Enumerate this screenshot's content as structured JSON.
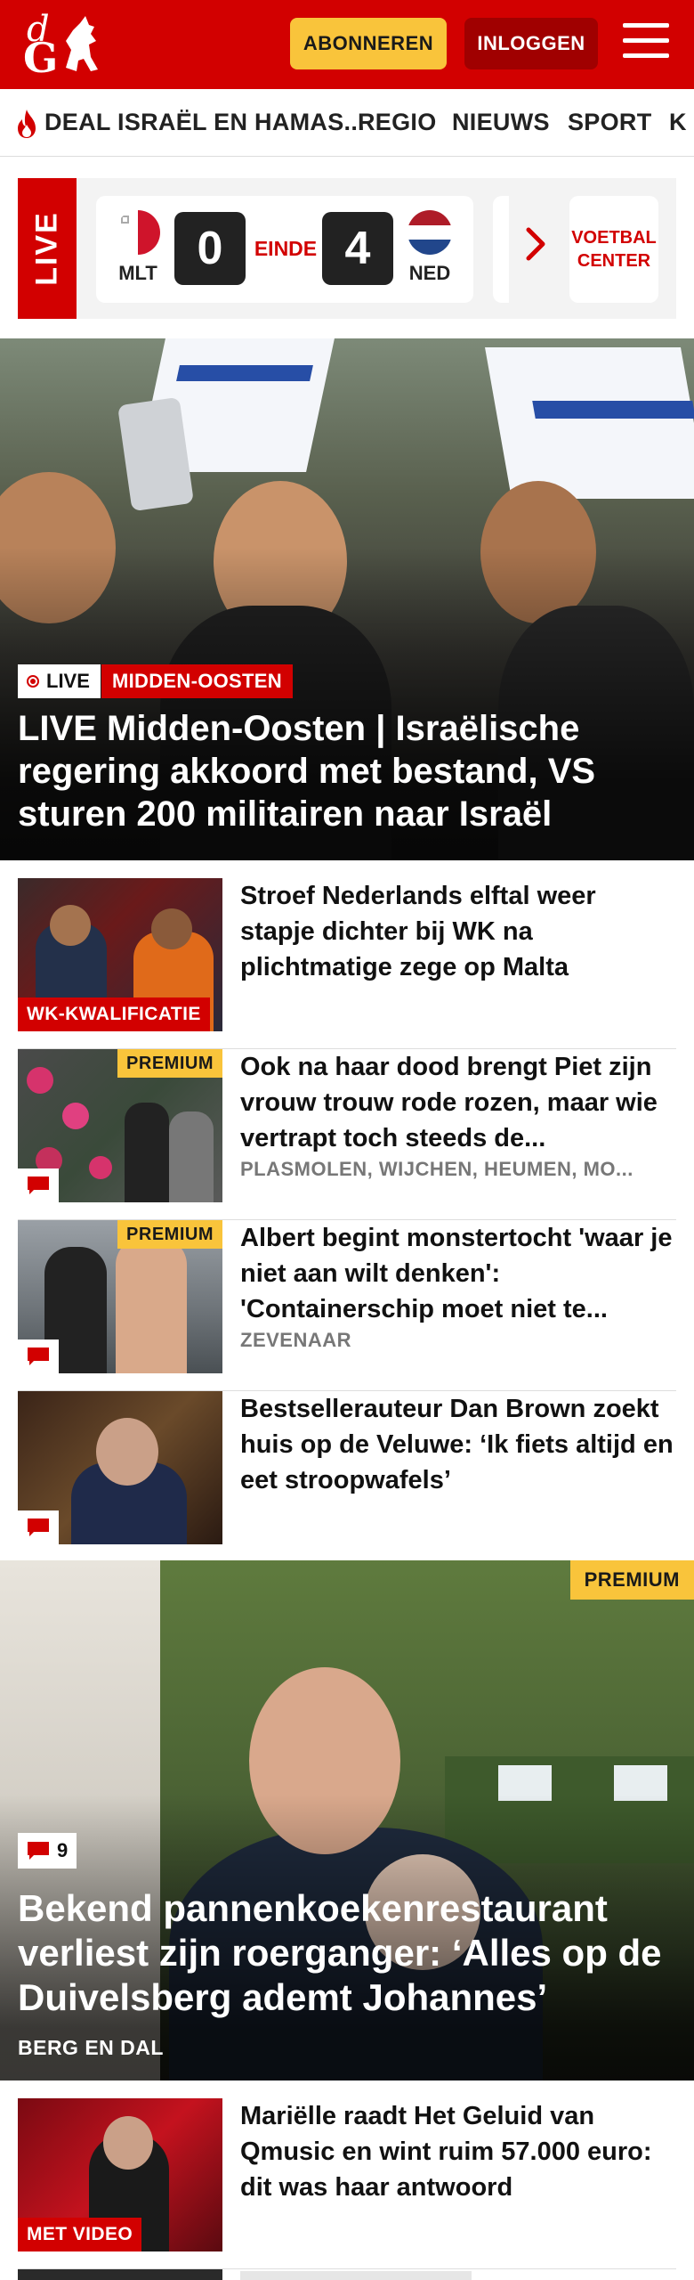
{
  "header": {
    "subscribe_label": "ABONNEREN",
    "login_label": "INLOGGEN",
    "logo_letters": "dG",
    "brand_color": "#d20000"
  },
  "nav": {
    "items": [
      "DEAL ISRAËL EN HAMAS...",
      "REGIO",
      "NIEUWS",
      "SPORT",
      "K"
    ]
  },
  "live": {
    "tab_label": "LIVE",
    "home_code": "MLT",
    "home_score": "0",
    "status": "EINDE",
    "away_score": "4",
    "away_code": "NED",
    "center_label_1": "VOETBAL",
    "center_label_2": "CENTER"
  },
  "hero": {
    "live_label": "LIVE",
    "category": "MIDDEN-OOSTEN",
    "title": "LIVE Midden-Oosten | Israëlische regering akkoord met bestand, VS sturen 200 militairen naar Israël"
  },
  "articles": [
    {
      "title": "Stroef Nederlands elftal weer stapje dichter bij WK na plichtmatige zege op Malta",
      "tag": "WK-KWALIFICATIE"
    },
    {
      "title": "Ook na haar dood brengt Piet zijn vrouw trouw rode rozen, maar wie vertrapt toch steeds de...",
      "location": "PLASMOLEN, WIJCHEN, HEUMEN, MO...",
      "premium": "PREMIUM"
    },
    {
      "title": "Albert begint monstertocht 'waar je niet aan wilt denken': 'Containerschip moet niet te...",
      "location": "ZEVENAAR",
      "premium": "PREMIUM"
    },
    {
      "title": "Bestsellerauteur Dan Brown zoekt huis op de Veluwe: ‘Ik fiets altijd en eet stroopwafels’"
    }
  ],
  "feature": {
    "premium": "PREMIUM",
    "comments": "9",
    "title": "Bekend pannenkoekenrestaurant verliest zijn roerganger: ‘Alles op de Duivelsberg ademt Johannes’",
    "location": "BERG EN DAL"
  },
  "bottom_article": {
    "title": "Mariëlle raadt Het Geluid van Qmusic en wint ruim 57.000 euro: dit was haar antwoord",
    "tag": "MET VIDEO"
  },
  "icons": {
    "flame": "flame-icon",
    "menu": "hamburger-menu-icon",
    "comment": "comment-icon",
    "chevron": "chevron-right-icon"
  }
}
